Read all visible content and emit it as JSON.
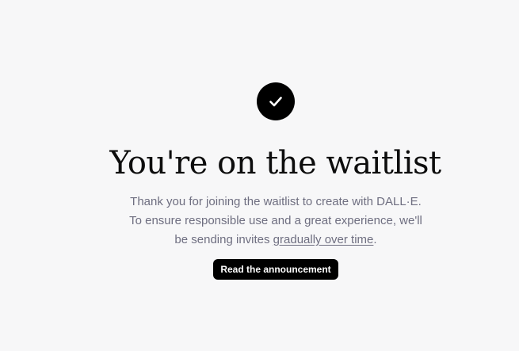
{
  "icons": {
    "status": "checkmark-icon"
  },
  "waitlist": {
    "title": "You're on the waitlist",
    "description_line1": "Thank you for joining the waitlist to create with DALL·E.",
    "description_line2": "To ensure responsible use and a great experience, we'll",
    "description_line3_prefix": "be sending invites ",
    "description_link": "gradually over time",
    "description_line3_suffix": ".",
    "button_label": "Read the announcement"
  },
  "colors": {
    "background": "#f7f7f8",
    "primary": "#000000",
    "text_muted": "#6e6e80"
  }
}
